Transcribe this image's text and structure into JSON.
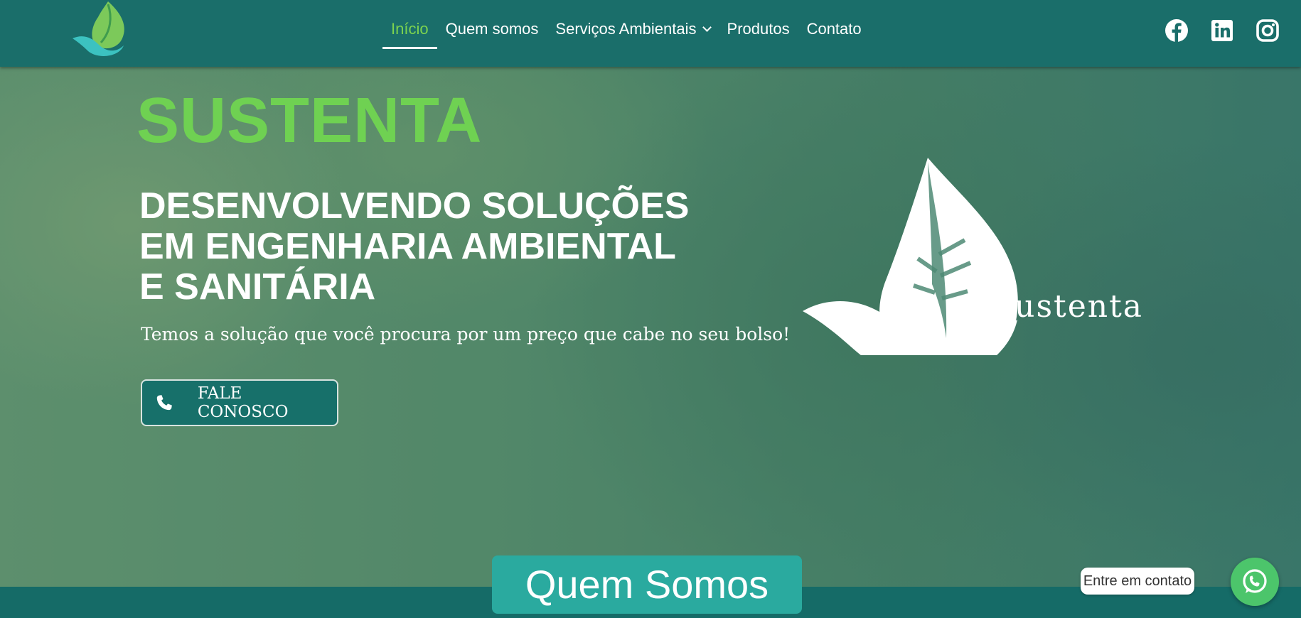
{
  "header": {
    "nav": [
      {
        "label": "Início",
        "active": true
      },
      {
        "label": "Quem somos"
      },
      {
        "label": "Serviços Ambientais",
        "has_dropdown": true
      },
      {
        "label": "Produtos"
      },
      {
        "label": "Contato"
      }
    ],
    "social_icons": [
      "facebook-icon",
      "linkedin-icon",
      "instagram-icon"
    ]
  },
  "hero": {
    "brand": "SUSTENTA",
    "headline_lines": [
      "DESENVOLVENDO SOLUÇÕES",
      "EM ENGENHARIA AMBIENTAL",
      "E SANITÁRIA"
    ],
    "tagline": "Temos a solução que você procura por um preço que cabe no seu bolso!",
    "cta_label": "FALE CONOSCO",
    "logo_text": "Sustenta"
  },
  "section": {
    "title": "Quem Somos"
  },
  "chat": {
    "label": "Entre em contato"
  },
  "colors": {
    "header": "#1a6e6a",
    "accent_green": "#6fd152",
    "button": "#17706a",
    "section_title": "#2aaa9f",
    "whatsapp": "#4cc56b"
  }
}
